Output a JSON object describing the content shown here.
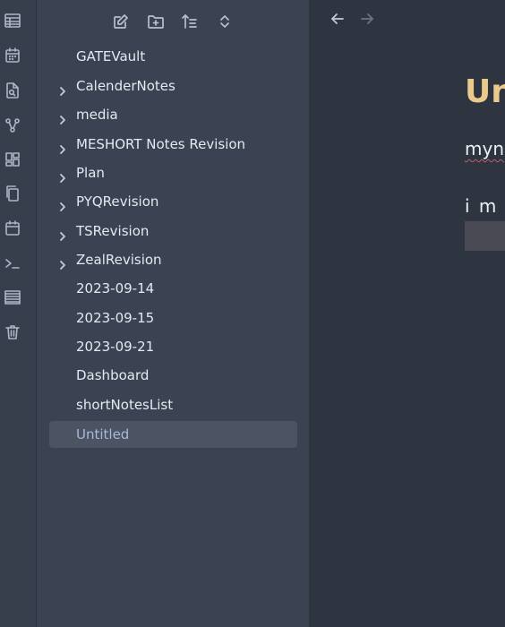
{
  "ribbon": {
    "icons": [
      "table-icon",
      "calendar-icon",
      "search-file-icon",
      "graph-icon",
      "layout-grid-icon",
      "copy-icon",
      "calendar-day-icon",
      "terminal-icon",
      "list-icon",
      "trash-icon"
    ]
  },
  "sidebar": {
    "actions": [
      "new-note-icon",
      "new-folder-icon",
      "sort-icon",
      "collapse-expand-icon"
    ],
    "items": [
      {
        "label": "GATEVault",
        "folder": false
      },
      {
        "label": "CalenderNotes",
        "folder": true
      },
      {
        "label": "media",
        "folder": true
      },
      {
        "label": "MESHORT Notes Revision",
        "folder": true
      },
      {
        "label": "Plan",
        "folder": true
      },
      {
        "label": "PYQRevision",
        "folder": true
      },
      {
        "label": "TSRevision",
        "folder": true
      },
      {
        "label": "ZealRevision",
        "folder": true
      },
      {
        "label": "2023-09-14",
        "folder": false
      },
      {
        "label": "2023-09-15",
        "folder": false
      },
      {
        "label": "2023-09-21",
        "folder": false
      },
      {
        "label": "Dashboard",
        "folder": false
      },
      {
        "label": "shortNotesList",
        "folder": false
      },
      {
        "label": "Untitled",
        "folder": false,
        "active": true
      }
    ]
  },
  "editor": {
    "title": "Un",
    "line1": "myn",
    "line2": "i m t"
  },
  "colors": {
    "accent_title": "#ebcb8b",
    "active_row": "#4c5363",
    "active_label": "#a8b8d8"
  }
}
